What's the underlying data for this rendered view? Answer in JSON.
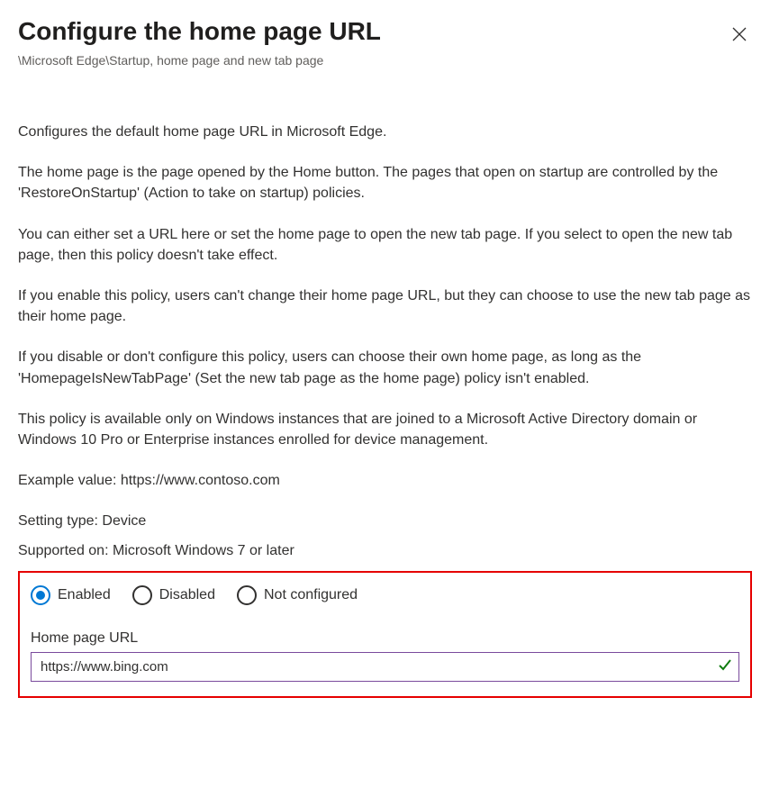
{
  "header": {
    "title": "Configure the home page URL",
    "breadcrumb": "\\Microsoft Edge\\Startup, home page and new tab page"
  },
  "description": {
    "p1": "Configures the default home page URL in Microsoft Edge.",
    "p2": "The home page is the page opened by the Home button. The pages that open on startup are controlled by the 'RestoreOnStartup' (Action to take on startup) policies.",
    "p3": "You can either set a URL here or set the home page to open the new tab page. If you select to open the new tab page, then this policy doesn't take effect.",
    "p4": "If you enable this policy, users can't change their home page URL, but they can choose to use the new tab page as their home page.",
    "p5": "If you disable or don't configure this policy, users can choose their own home page, as long as the 'HomepageIsNewTabPage' (Set the new tab page as the home page) policy isn't enabled.",
    "p6": "This policy is available only on Windows instances that are joined to a Microsoft Active Directory domain or Windows 10 Pro or Enterprise instances enrolled for device management.",
    "example": "Example value: https://www.contoso.com",
    "setting_type": "Setting type: Device",
    "supported_on": "Supported on: Microsoft Windows 7 or later"
  },
  "config": {
    "radios": {
      "enabled": "Enabled",
      "disabled": "Disabled",
      "not_configured": "Not configured"
    },
    "field_label": "Home page URL",
    "url_value": "https://www.bing.com"
  }
}
